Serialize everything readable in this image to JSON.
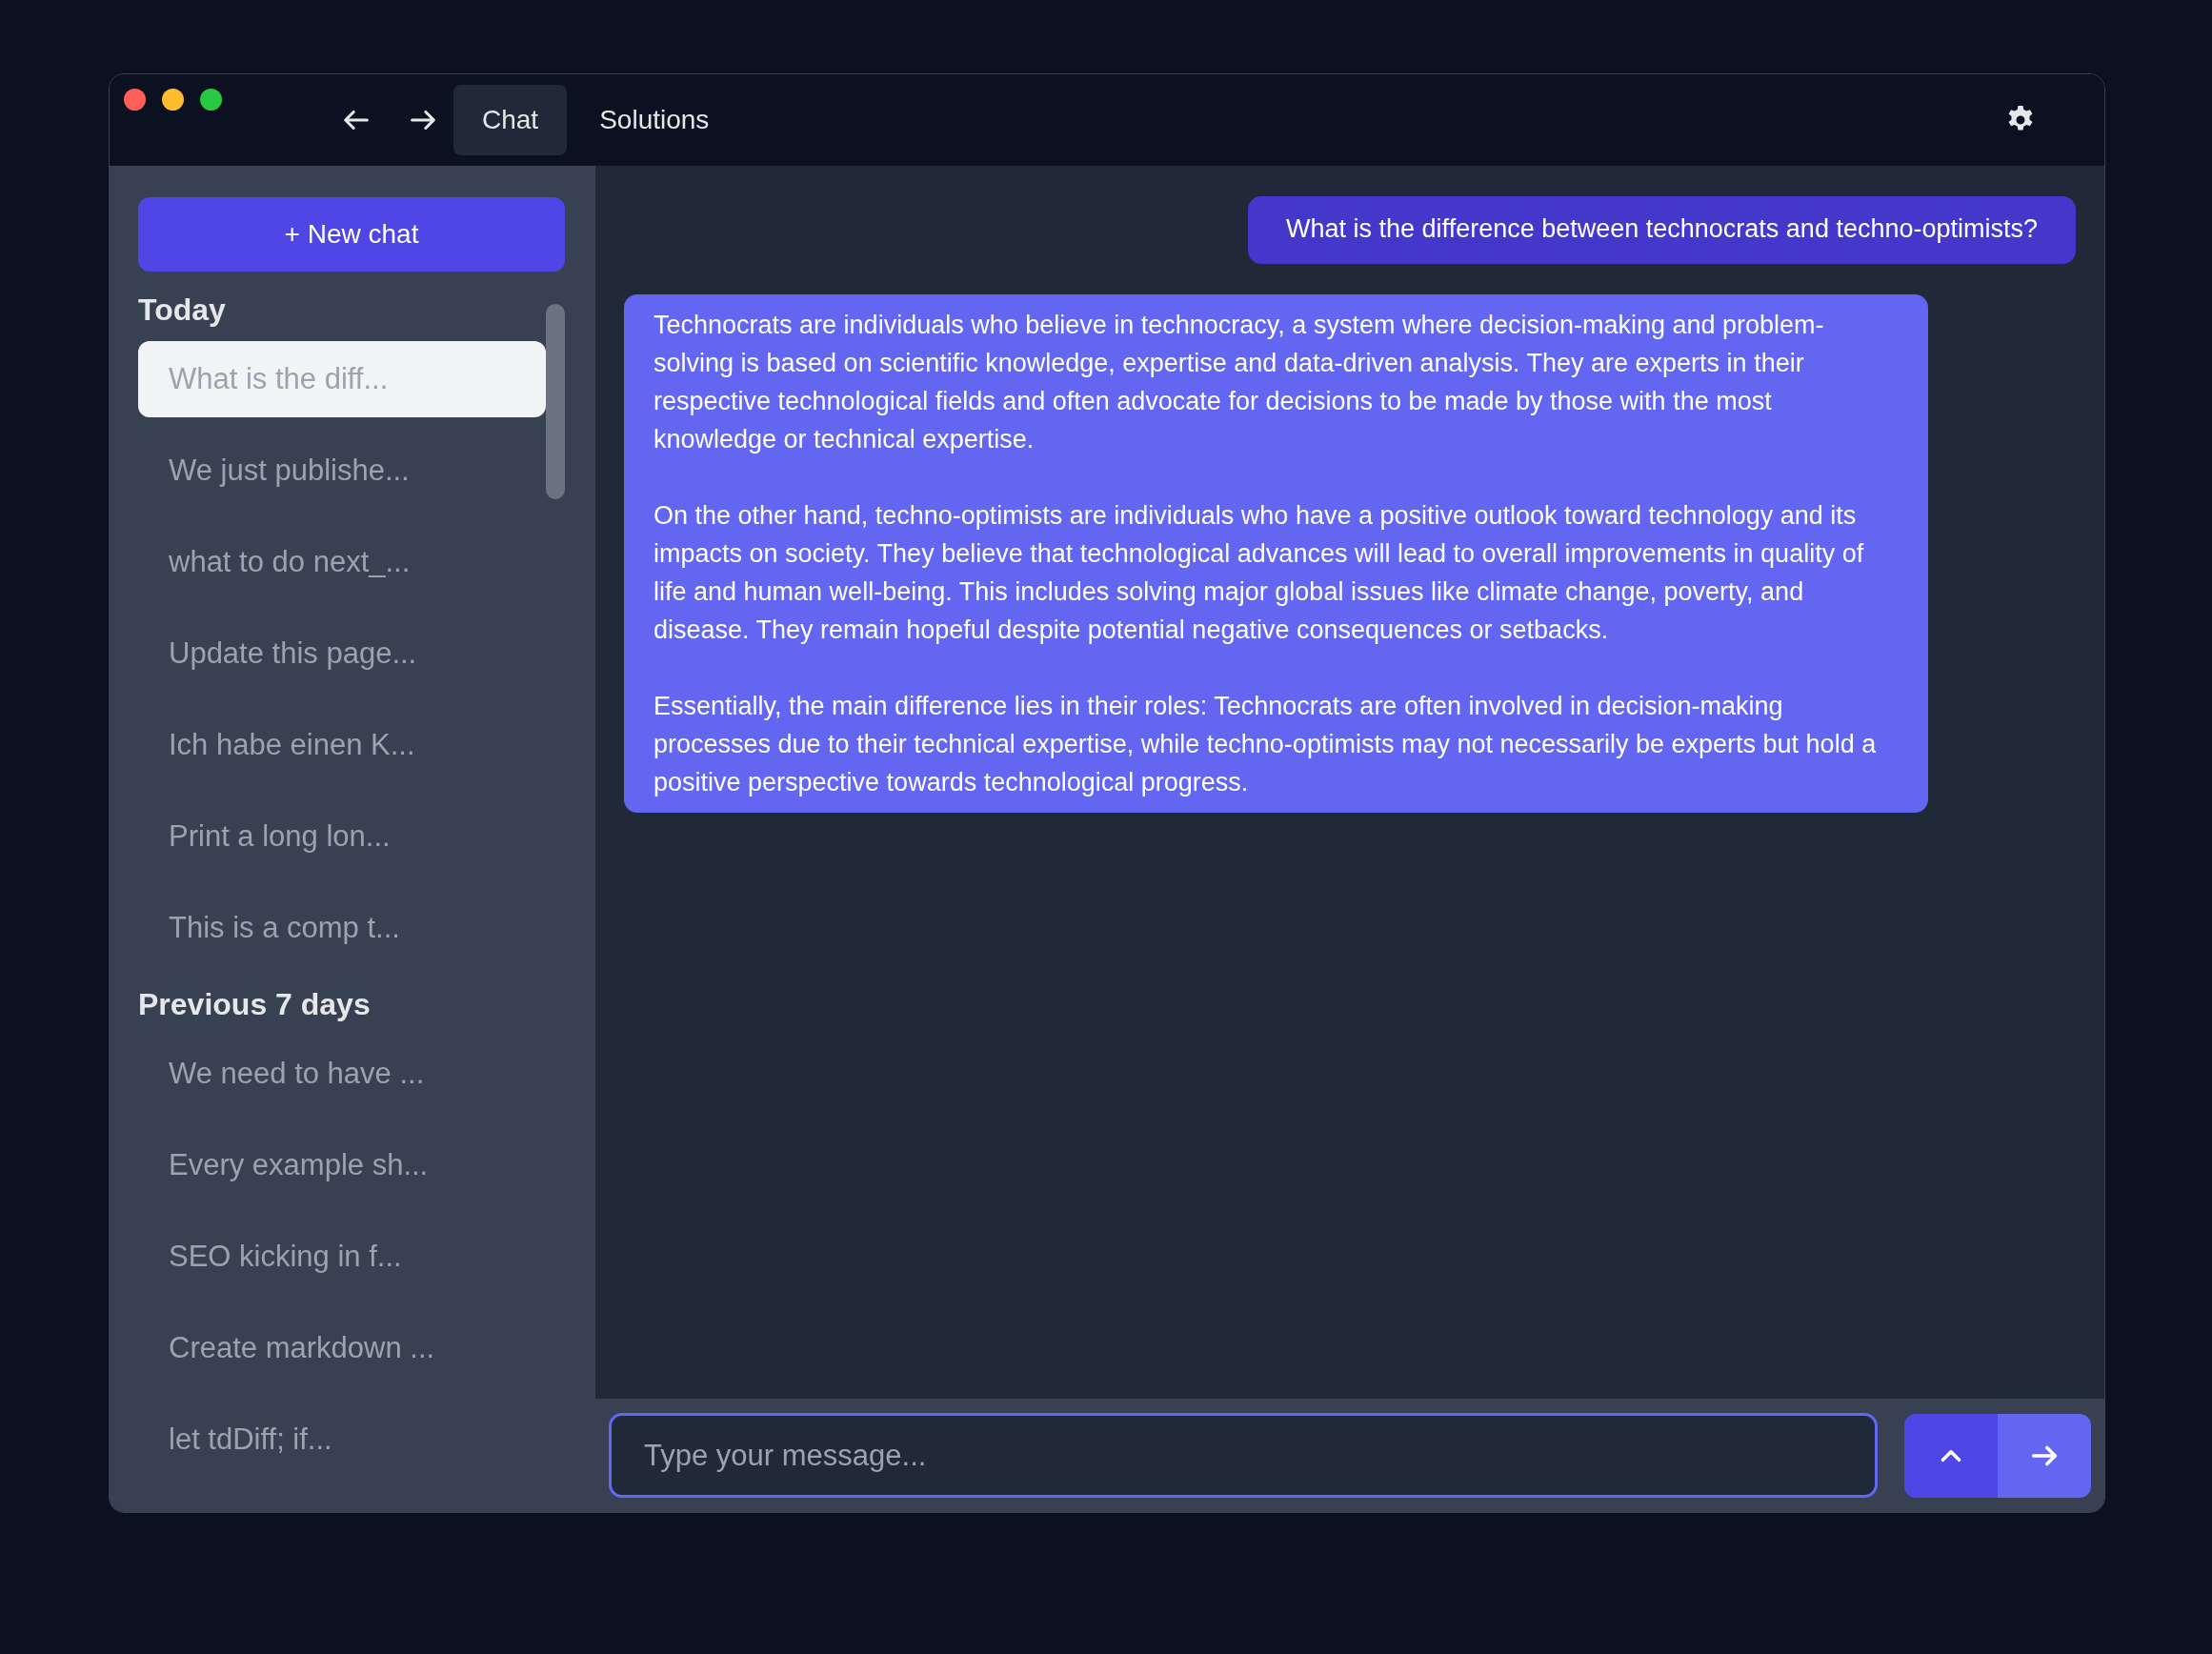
{
  "tabs": [
    {
      "label": "Chat",
      "selected": true
    },
    {
      "label": "Solutions",
      "selected": false
    }
  ],
  "sidebar": {
    "new_chat_button": "+ New chat",
    "sections": [
      {
        "title": "Today",
        "items": [
          {
            "label": "What is the diff...",
            "selected": true
          },
          {
            "label": "We just publishe...",
            "selected": false
          },
          {
            "label": "what to do next_...",
            "selected": false
          },
          {
            "label": "Update this page...",
            "selected": false
          },
          {
            "label": "Ich habe einen K...",
            "selected": false
          },
          {
            "label": "Print a long lon...",
            "selected": false
          },
          {
            "label": "This is a comp t...",
            "selected": false
          }
        ]
      },
      {
        "title": "Previous 7 days",
        "items": [
          {
            "label": "We need to have ...",
            "selected": false
          },
          {
            "label": "Every example sh...",
            "selected": false
          },
          {
            "label": "SEO kicking in f...",
            "selected": false
          },
          {
            "label": "Create markdown ...",
            "selected": false
          },
          {
            "label": "let tdDiff; if...",
            "selected": false
          }
        ]
      }
    ]
  },
  "messages": [
    {
      "kind": "user",
      "paragraphs": [
        "What is the difference between technocrats and techno-optimists?"
      ]
    },
    {
      "kind": "assistant",
      "paragraphs": [
        "Technocrats are individuals who believe in technocracy, a system where decision-making and problem-solving is based on scientific knowledge, expertise and data-driven analysis. They are experts in their respective technological fields and often advocate for decisions to be made by those with the most knowledge or technical expertise.",
        "On the other hand, techno-optimists are individuals who have a positive outlook toward technology and its impacts on society. They believe that technological advances will lead to overall improvements in quality of life and human well-being. This includes solving major global issues like climate change, poverty, and disease. They remain hopeful despite potential negative consequences or setbacks.",
        "Essentially, the main difference lies in their roles: Technocrats are often involved in decision-making processes due to their technical expertise, while techno-optimists may not necessarily be experts but hold a positive perspective towards technological progress."
      ]
    }
  ],
  "composer": {
    "placeholder": "Type your message..."
  }
}
